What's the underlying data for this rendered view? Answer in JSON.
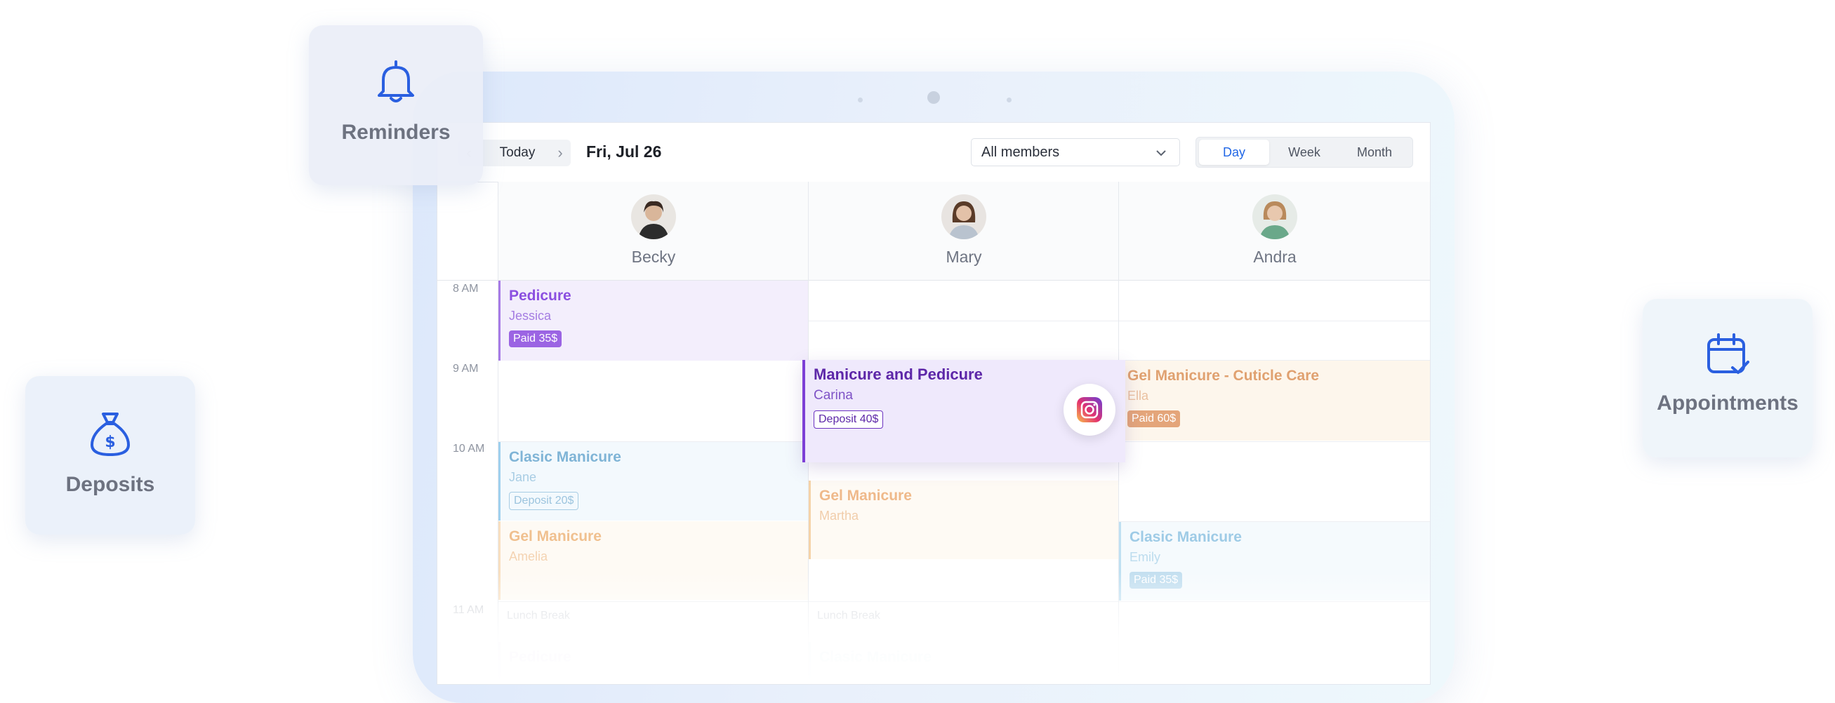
{
  "features": {
    "reminders": {
      "label": "Reminders",
      "icon": "bell-icon"
    },
    "deposits": {
      "label": "Deposits",
      "icon": "money-bag-icon"
    },
    "appointments": {
      "label": "Appointments",
      "icon": "calendar-check-icon"
    }
  },
  "toolbar": {
    "today_label": "Today",
    "date": "Fri, Jul 26",
    "member_select": "All members",
    "views": [
      {
        "label": "Day",
        "active": true
      },
      {
        "label": "Week",
        "active": false
      },
      {
        "label": "Month",
        "active": false
      }
    ]
  },
  "staff": [
    {
      "name": "Becky"
    },
    {
      "name": "Mary"
    },
    {
      "name": "Andra"
    }
  ],
  "times": [
    "8 AM",
    "9 AM",
    "10 AM",
    "11 AM"
  ],
  "events": {
    "pedicure_becky": {
      "title": "Pedicure",
      "client": "Jessica",
      "badge": "Paid 35$"
    },
    "manicure_pedicure_mary": {
      "title": "Manicure and Pedicure",
      "client": "Carina",
      "badge": "Deposit 40$"
    },
    "gel_cuticle_andra": {
      "title": "Gel Manicure - Cuticle Care",
      "client": "Ella",
      "badge": "Paid 60$"
    },
    "clasic_becky": {
      "title": "Clasic Manicure",
      "client": "Jane",
      "badge": "Deposit 20$"
    },
    "gel_mary": {
      "title": "Gel Manicure",
      "client": "Martha"
    },
    "gel_becky": {
      "title": "Gel Manicure",
      "client": "Amelia"
    },
    "clasic_andra": {
      "title": "Clasic Manicure",
      "client": "Emily",
      "badge": "Paid 35$"
    },
    "lunch_becky": {
      "title": "Lunch Break"
    },
    "lunch_mary": {
      "title": "Lunch Break"
    },
    "pedicure_becky_2": {
      "title": "Pedicure"
    },
    "clasic_mary_2": {
      "title": "Clasic Manicure"
    }
  },
  "colors": {
    "accent": "#2167e6",
    "purple": "#8b4fe0",
    "orange": "#e58a3a",
    "blue": "#5aa3d8"
  }
}
